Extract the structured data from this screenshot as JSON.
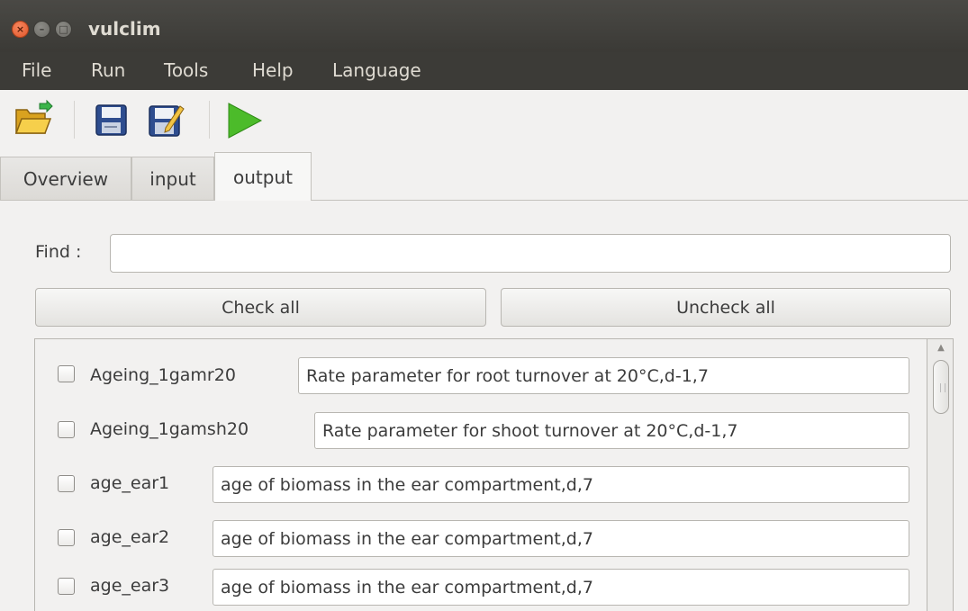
{
  "window": {
    "title": "vulclim"
  },
  "menu": {
    "file": "File",
    "run": "Run",
    "tools": "Tools",
    "help": "Help",
    "language": "Language"
  },
  "toolbar": {
    "icons": [
      "open-folder-icon",
      "save-icon",
      "edit-icon",
      "run-icon"
    ]
  },
  "tabs": [
    {
      "label": "Overview",
      "active": false
    },
    {
      "label": "input",
      "active": false
    },
    {
      "label": "output",
      "active": true
    }
  ],
  "find": {
    "label": "Find :",
    "value": ""
  },
  "buttons": {
    "check_all": "Check all",
    "uncheck_all": "Uncheck all"
  },
  "rows": [
    {
      "name": "Ageing_1gamr20",
      "description": "Rate parameter for root turnover at 20°C,d-1,7",
      "checked": false
    },
    {
      "name": "Ageing_1gamsh20",
      "description": "Rate parameter for shoot turnover at 20°C,d-1,7",
      "checked": false
    },
    {
      "name": "age_ear1",
      "description": "age of biomass in the ear compartment,d,7",
      "checked": false
    },
    {
      "name": "age_ear2",
      "description": "age of biomass in the ear compartment,d,7",
      "checked": false
    },
    {
      "name": "age_ear3",
      "description": "age of biomass in the ear compartment,d,7",
      "checked": false
    }
  ]
}
